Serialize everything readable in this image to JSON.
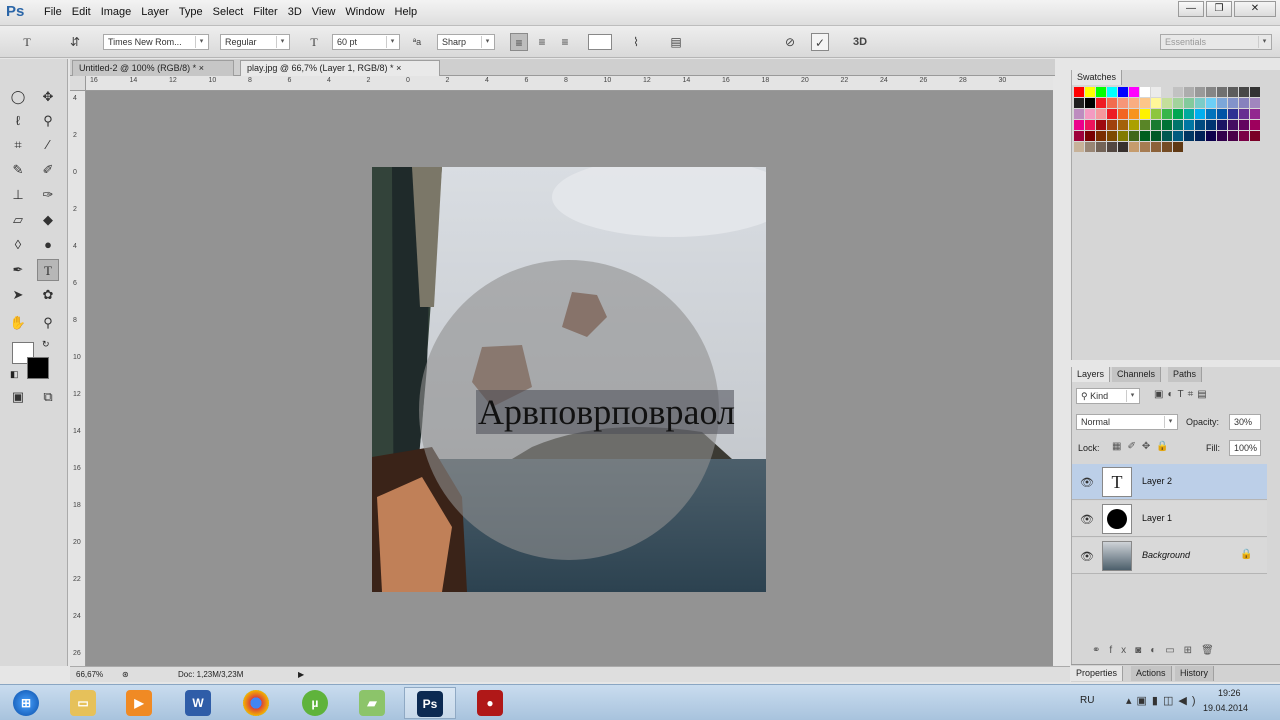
{
  "app": {
    "logo": "Ps"
  },
  "menu": [
    "File",
    "Edit",
    "Image",
    "Layer",
    "Type",
    "Select",
    "Filter",
    "3D",
    "View",
    "Window",
    "Help"
  ],
  "window_buttons": {
    "minimize": "—",
    "restore": "❐",
    "close": "✕"
  },
  "options": {
    "font_family": "Times New Rom...",
    "font_style": "Regular",
    "font_size": "60 pt",
    "antialias": "Sharp",
    "mode_3d": "3D",
    "workspace": "Essentials"
  },
  "doc_tabs": [
    {
      "label": "Untitled-2 @ 100% (RGB/8) *",
      "close": "×"
    },
    {
      "label": "play.jpg @ 66,7% (Layer 1, RGB/8) *",
      "close": "×"
    }
  ],
  "ruler_h": [
    "16",
    "14",
    "12",
    "10",
    "8",
    "6",
    "4",
    "2",
    "0",
    "2",
    "4",
    "6",
    "8",
    "10",
    "12",
    "14",
    "16",
    "18",
    "20",
    "22",
    "24",
    "26",
    "28",
    "30"
  ],
  "ruler_v": [
    "4",
    "2",
    "0",
    "2",
    "4",
    "6",
    "8",
    "10",
    "12",
    "14",
    "16",
    "18",
    "20",
    "22",
    "24",
    "26"
  ],
  "canvas_text": "Арвповрповраол",
  "status": {
    "zoom": "66,67%",
    "doc": "Doc: 1,23M/3,23M"
  },
  "panels": {
    "swatches_tab": "Swatches",
    "layers_tabs": [
      "Layers",
      "Channels",
      "Paths"
    ],
    "kind": "Kind",
    "blend_mode": "Normal",
    "opacity_label": "Opacity:",
    "opacity_value": "30%",
    "lock_label": "Lock:",
    "fill_label": "Fill:",
    "fill_value": "100%",
    "bottom_tabs": [
      "Properties",
      "Actions",
      "History"
    ]
  },
  "layers": [
    {
      "name": "Layer 2",
      "type": "text",
      "selected": true
    },
    {
      "name": "Layer 1",
      "type": "shape",
      "selected": false
    },
    {
      "name": "Background",
      "type": "image",
      "selected": false,
      "locked": true
    }
  ],
  "swatch_colors": [
    "#ff0000",
    "#ffff00",
    "#00ff00",
    "#00ffff",
    "#0000ff",
    "#ff00ff",
    "#ffffff",
    "#ebebeb",
    "#d6d6d6",
    "#c2c2c2",
    "#adadad",
    "#999999",
    "#858585",
    "#707070",
    "#5c5c5c",
    "#474747",
    "#333333",
    "#1f1f1f",
    "#000000",
    "#ee1c24",
    "#f26c4f",
    "#f69679",
    "#f9ad81",
    "#fdc689",
    "#fff799",
    "#c4df9b",
    "#a2d39c",
    "#82ca9c",
    "#7accc8",
    "#6dcff6",
    "#7da7d9",
    "#8393ca",
    "#8781bd",
    "#a186be",
    "#bd8cbf",
    "#f49ac1",
    "#f5989d",
    "#ed1c24",
    "#f26522",
    "#f7941d",
    "#fff200",
    "#8dc63f",
    "#39b54a",
    "#00a651",
    "#00a99d",
    "#00aeef",
    "#0072bc",
    "#0054a6",
    "#2e3192",
    "#662d91",
    "#92278f",
    "#ec008c",
    "#ed145b",
    "#9e0b0f",
    "#a0410d",
    "#a3620a",
    "#aba000",
    "#598527",
    "#197b30",
    "#007236",
    "#00746b",
    "#0076a3",
    "#004a80",
    "#003471",
    "#1b1464",
    "#440e62",
    "#630460",
    "#9e005d",
    "#9e0039",
    "#790000",
    "#7b2e00",
    "#7d4900",
    "#827b00",
    "#406618",
    "#005e20",
    "#005826",
    "#005952",
    "#005b7f",
    "#003663",
    "#002157",
    "#0d004c",
    "#32004b",
    "#4b0049",
    "#7b0046",
    "#7a0026",
    "#c7b299",
    "#998675",
    "#736357",
    "#534741",
    "#37302d",
    "#c69c6d",
    "#a67c52",
    "#8c6239",
    "#754c24",
    "#603913"
  ],
  "taskbar": {
    "time": "19:26",
    "date": "19.04.2014",
    "lang": "RU"
  }
}
